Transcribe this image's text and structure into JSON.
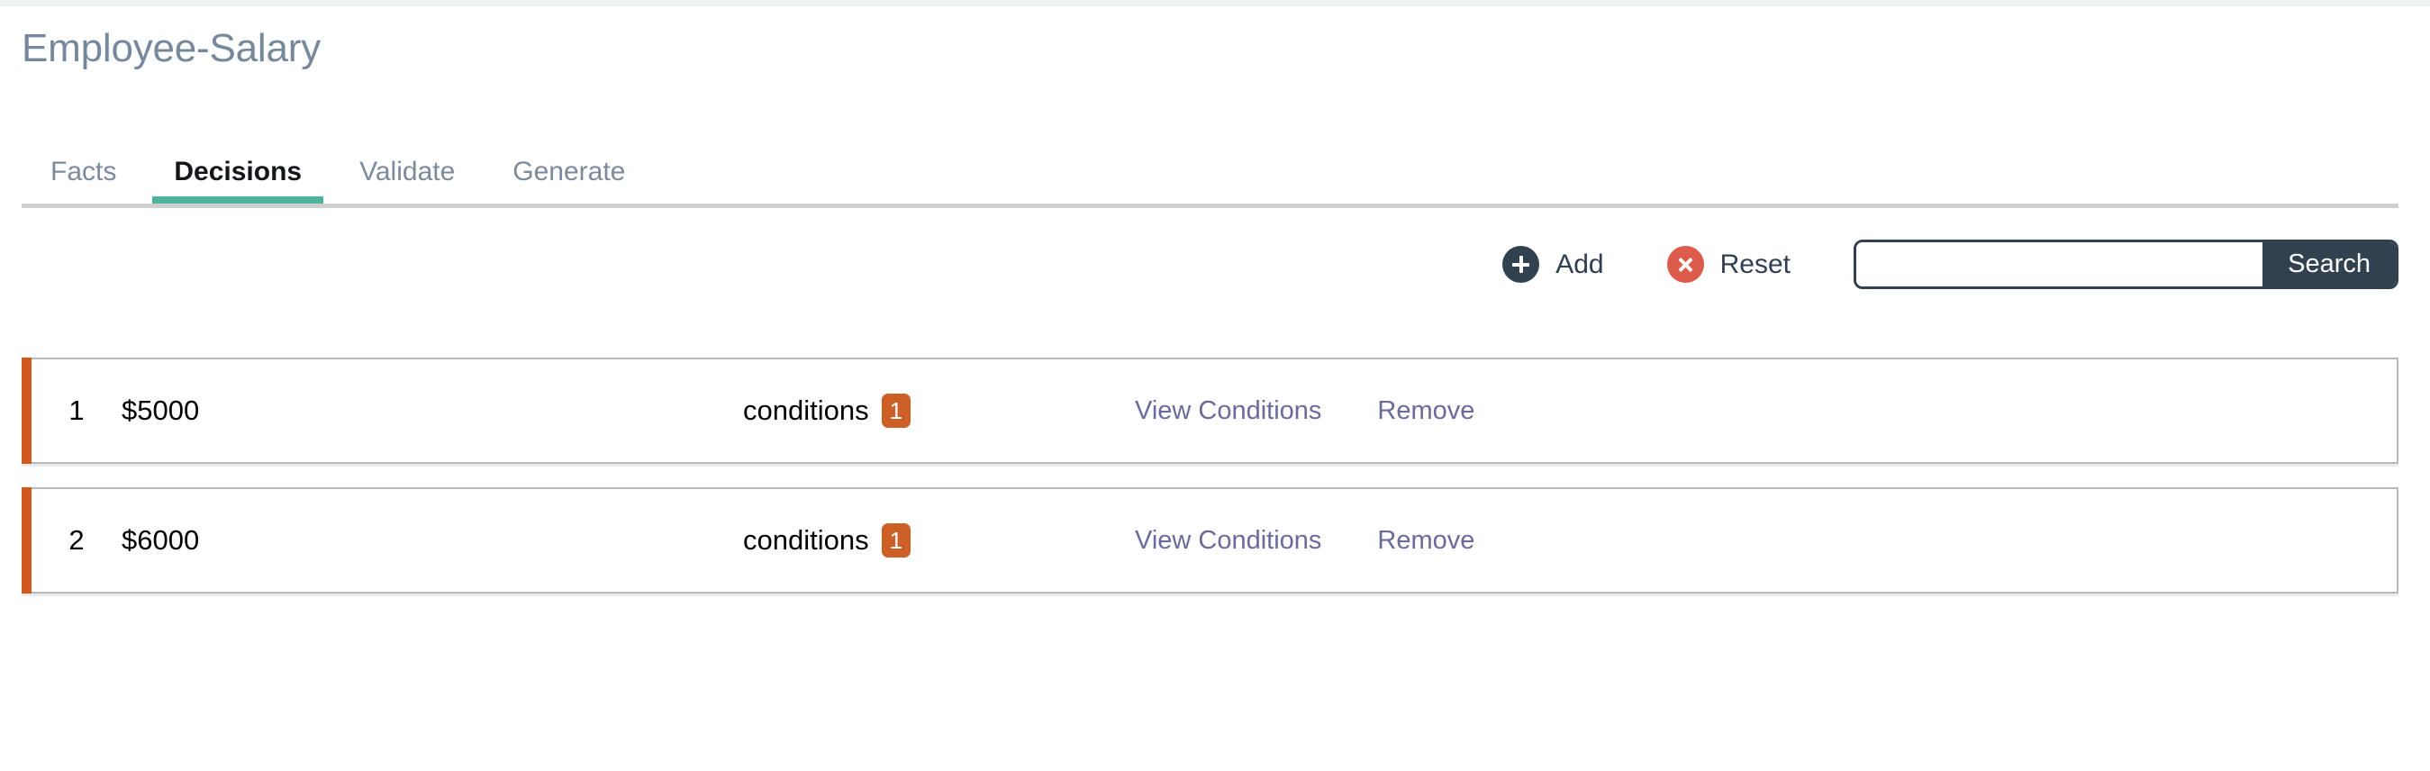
{
  "header": {
    "title": "Employee-Salary"
  },
  "tabs": [
    {
      "label": "Facts",
      "active": false
    },
    {
      "label": "Decisions",
      "active": true
    },
    {
      "label": "Validate",
      "active": false
    },
    {
      "label": "Generate",
      "active": false
    }
  ],
  "toolbar": {
    "add_label": "Add",
    "add_icon": "plus-circle-icon",
    "reset_label": "Reset",
    "reset_icon": "x-circle-icon",
    "search_value": "",
    "search_placeholder": "",
    "search_button_label": "Search"
  },
  "colors": {
    "title": "#76889b",
    "tab_active_underline": "#4fb39b",
    "accent_orange": "#d1591f",
    "badge_orange": "#cc5f26",
    "dark_navy": "#32414f",
    "reset_red": "#dd5b4b",
    "link_purple": "#6a6a9c"
  },
  "decisions": {
    "conditions_label": "conditions",
    "view_label": "View Conditions",
    "remove_label": "Remove",
    "rows": [
      {
        "index": "1",
        "value": "$5000",
        "conditions_label": "conditions",
        "conditions_count": "1",
        "view_label": "View Conditions",
        "remove_label": "Remove"
      },
      {
        "index": "2",
        "value": "$6000",
        "conditions_label": "conditions",
        "conditions_count": "1",
        "view_label": "View Conditions",
        "remove_label": "Remove"
      }
    ]
  }
}
